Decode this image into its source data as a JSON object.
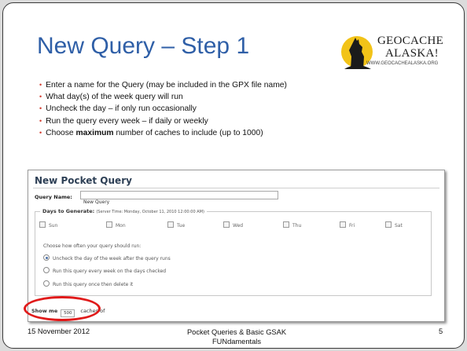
{
  "slide": {
    "title": "New Query – Step 1",
    "logo": {
      "line1": "GEOCACHE",
      "line2": "ALASKA!",
      "url": "WWW.GEOCACHEALASKA.ORG"
    },
    "bullets": [
      {
        "pre": "Enter a name for the Query (may be included in the GPX file name)",
        "bold": "",
        "post": ""
      },
      {
        "pre": "What day(s) of the week query will run",
        "bold": "",
        "post": ""
      },
      {
        "pre": "Uncheck the day – if only run occasionally",
        "bold": "",
        "post": ""
      },
      {
        "pre": "Run the query every week – if daily or weekly",
        "bold": "",
        "post": ""
      },
      {
        "pre": "Choose ",
        "bold": "maximum",
        "post": " number of caches to include (up to 1000)"
      }
    ],
    "bullet_color": "#d23a2d",
    "title_color": "#2f5fa7"
  },
  "screenshot": {
    "heading": "New Pocket Query",
    "query_name_label": "Query Name:",
    "query_name_value": "New Query",
    "days_legend": "Days to Generate:",
    "days_server_time": "(Server Time: Monday, October 11, 2010 12:00:00 AM)",
    "days": [
      "Sun",
      "Mon",
      "Tue",
      "Wed",
      "Thu",
      "Fri",
      "Sat"
    ],
    "run_question": "Choose how often your query should run:",
    "run_options": [
      {
        "label": "Uncheck the day of the week after the query runs",
        "selected": true
      },
      {
        "label": "Run this query every week on the days checked",
        "selected": false
      },
      {
        "label": "Run this query once then delete it",
        "selected": false
      }
    ],
    "show_me_label": "Show me",
    "max_value": "500",
    "caches_of_label": "caches of",
    "highlight_color": "#e01a1a"
  },
  "footer": {
    "date": "15 November  2012",
    "middle_line1": "Pocket Queries & Basic GSAK",
    "middle_line2": "FUNdamentals",
    "page_number": "5"
  }
}
